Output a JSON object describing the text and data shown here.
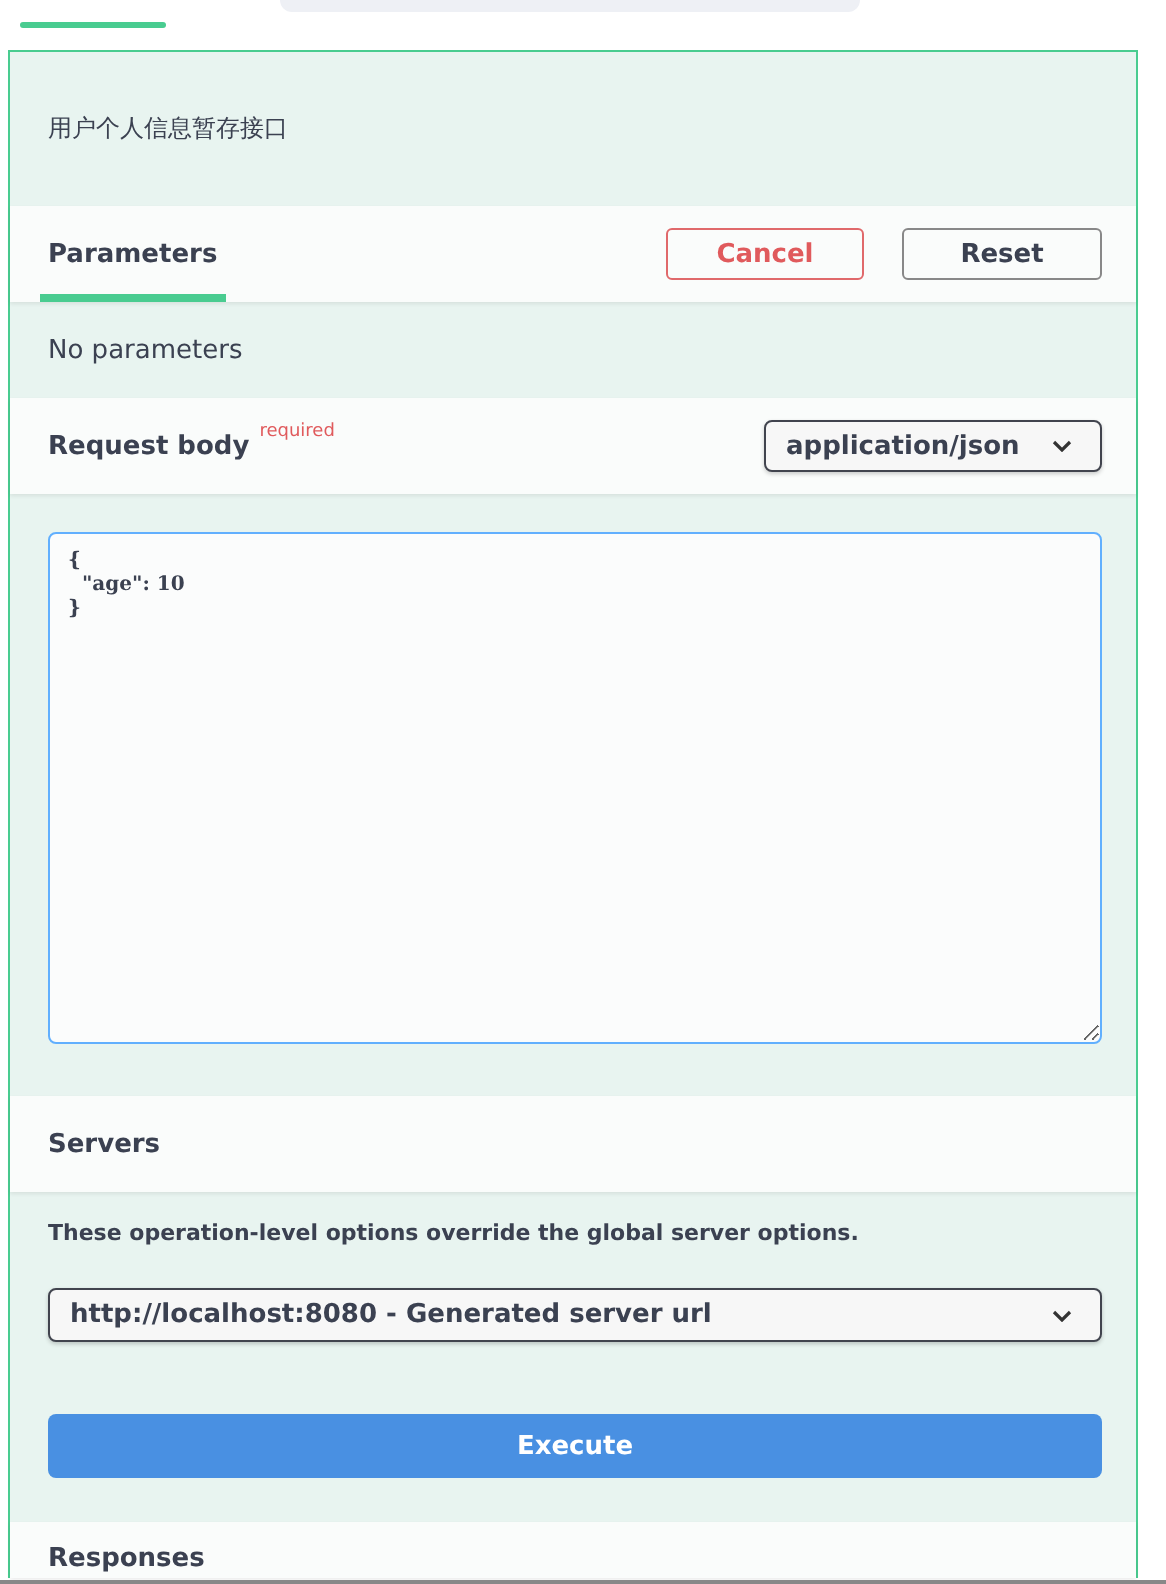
{
  "description": "用户个人信息暂存接口",
  "parameters": {
    "tabs": [
      {
        "label": "Parameters",
        "selected": true
      }
    ],
    "buttons": [
      {
        "label": "Cancel",
        "kind": "cancel"
      },
      {
        "label": "Reset",
        "kind": "reset"
      }
    ],
    "empty_text": "No parameters"
  },
  "request_body": {
    "title": "Request body",
    "required_label": "required",
    "media_type": "application/json",
    "code_lines": [
      "{",
      "  \"age\": 10",
      "}"
    ]
  },
  "servers": {
    "title": "Servers",
    "note": "These operation-level options override the global server options.",
    "selected_server": "http://localhost:8080 - Generated server url"
  },
  "execute_button": "Execute",
  "responses_title": "Responses"
}
